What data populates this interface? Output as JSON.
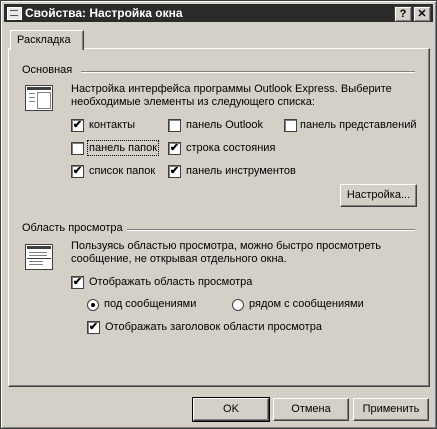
{
  "window": {
    "title": "Свойства: Настройка окна",
    "help_btn": "?",
    "close_btn": "✕"
  },
  "tabs": [
    {
      "label": "Раскладка",
      "active": true
    }
  ],
  "basic": {
    "title": "Основная",
    "desc_line1": "Настройка интерфейса программы Outlook Express. Выберите",
    "desc_line2": "необходимые элементы из следующего списка:",
    "checkboxes": [
      {
        "label": "контакты",
        "checked": true
      },
      {
        "label": "панель Outlook",
        "checked": false
      },
      {
        "label": "панель представлений",
        "checked": false
      },
      {
        "label": "панель папок",
        "checked": false
      },
      {
        "label": "строка состояния",
        "checked": true
      },
      {
        "label": "список папок",
        "checked": true
      },
      {
        "label": "панель инструментов",
        "checked": true
      }
    ],
    "customize_btn": "Настройка..."
  },
  "preview": {
    "title": "Область просмотра",
    "desc_line1": "Пользуясь областью просмотра, можно быстро просмотреть",
    "desc_line2": "сообщение, не открывая отдельного окна.",
    "show_preview": {
      "label": "Отображать область просмотра",
      "checked": true
    },
    "radios": [
      {
        "label": "под сообщениями",
        "selected": true
      },
      {
        "label": "рядом с сообщениями",
        "selected": false
      }
    ],
    "show_header": {
      "label": "Отображать заголовок области просмотра",
      "checked": true
    }
  },
  "buttons": {
    "ok": "OK",
    "cancel": "Отмена",
    "apply": "Применить"
  },
  "check_mark": "✔"
}
